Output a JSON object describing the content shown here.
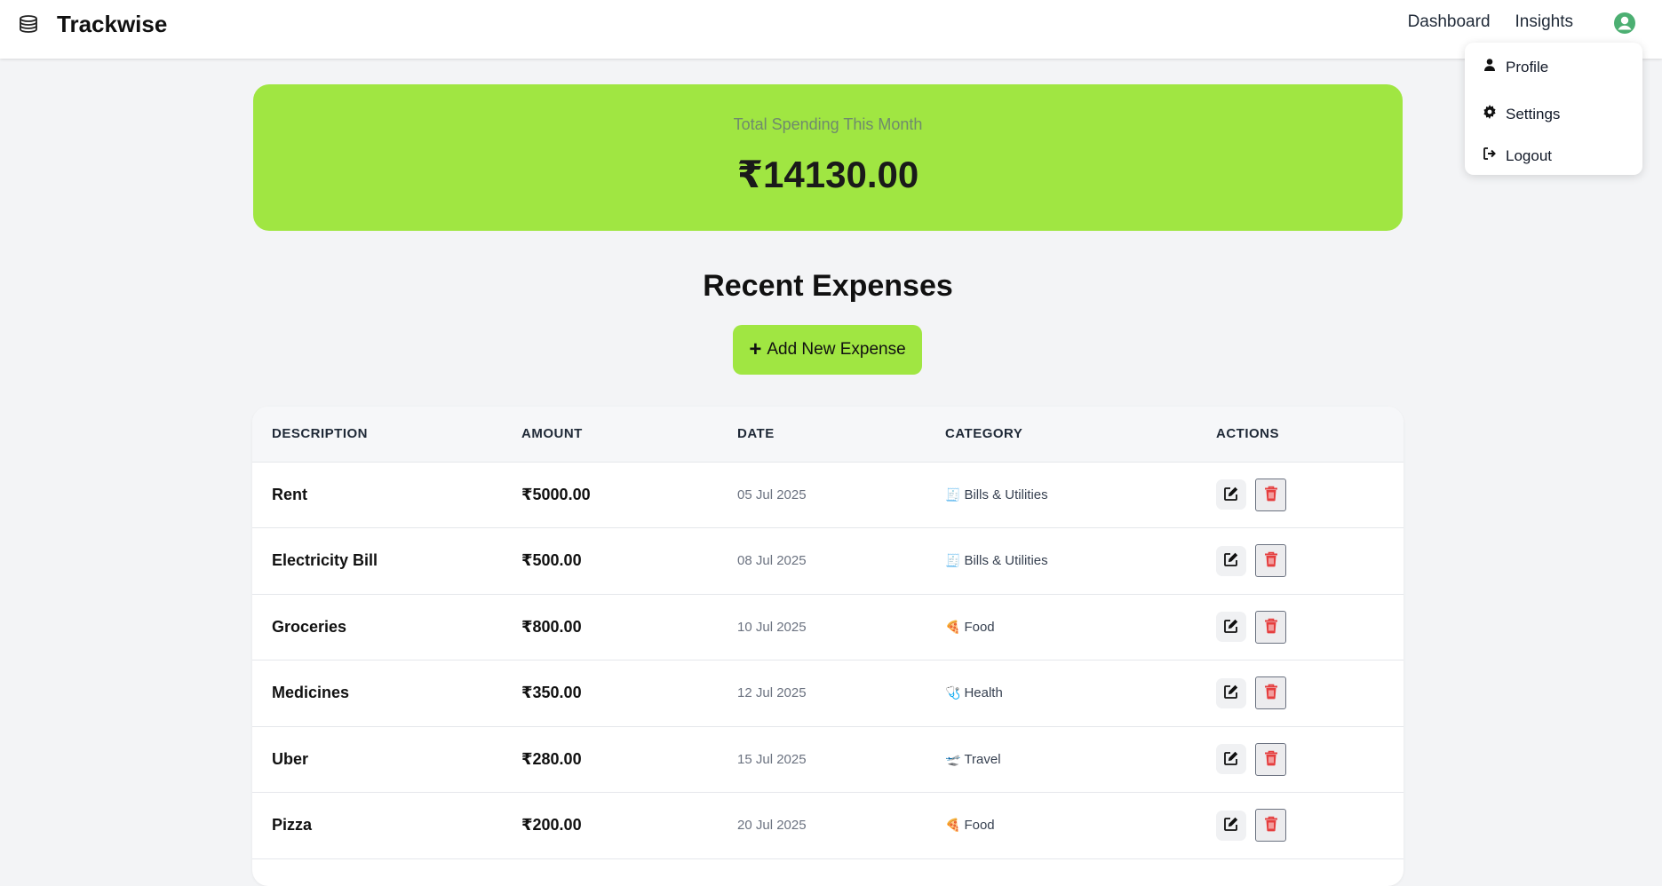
{
  "app": {
    "name": "Trackwise",
    "logo_icon": "coin-stack-icon"
  },
  "nav": {
    "dashboard": "Dashboard",
    "insights": "Insights",
    "avatar_icon": "user-circle-icon"
  },
  "dropdown": {
    "items": [
      {
        "label": "Profile",
        "icon": "user-icon"
      },
      {
        "label": "Settings",
        "icon": "gear-icon"
      },
      {
        "label": "Logout",
        "icon": "logout-icon"
      }
    ]
  },
  "summary": {
    "label": "Total Spending This Month",
    "amount": "₹14130.00"
  },
  "expenses": {
    "title": "Recent Expenses",
    "add_button": "Add New Expense",
    "columns": [
      "DESCRIPTION",
      "AMOUNT",
      "DATE",
      "CATEGORY",
      "ACTIONS"
    ],
    "rows": [
      {
        "description": "Rent",
        "amount": "₹5000.00",
        "date": "05 Jul 2025",
        "category": "Bills & Utilities",
        "category_icon": "🧾"
      },
      {
        "description": "Electricity Bill",
        "amount": "₹500.00",
        "date": "08 Jul 2025",
        "category": "Bills & Utilities",
        "category_icon": "🧾"
      },
      {
        "description": "Groceries",
        "amount": "₹800.00",
        "date": "10 Jul 2025",
        "category": "Food",
        "category_icon": "🍕"
      },
      {
        "description": "Medicines",
        "amount": "₹350.00",
        "date": "12 Jul 2025",
        "category": "Health",
        "category_icon": "🩺"
      },
      {
        "description": "Uber",
        "amount": "₹280.00",
        "date": "15 Jul 2025",
        "category": "Travel",
        "category_icon": "🛫"
      },
      {
        "description": "Pizza",
        "amount": "₹200.00",
        "date": "20 Jul 2025",
        "category": "Food",
        "category_icon": "🍕"
      }
    ]
  },
  "colors": {
    "accent": "#a0e642",
    "delete": "#e53e3e",
    "avatar": "#4caf72"
  }
}
